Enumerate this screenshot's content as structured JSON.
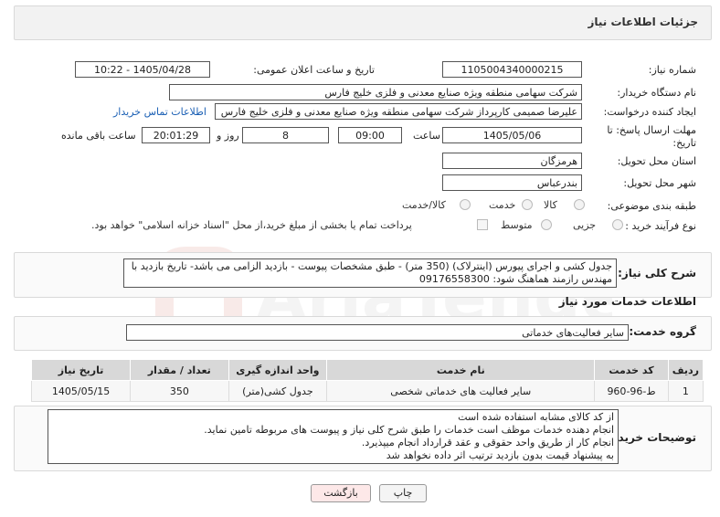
{
  "header": {
    "title": "جزئیات اطلاعات نیاز"
  },
  "fields": {
    "need_number_label": "شماره نیاز:",
    "need_number": "1105004340000215",
    "announce_label": "تاریخ و ساعت اعلان عمومی:",
    "announce_value": "1405/04/28 - 10:22",
    "buyer_label": "نام دستگاه خریدار:",
    "buyer_value": "شرکت سهامی منطقه ویژه صنایع معدنی و فلزی خلیج فارس",
    "creator_label": "ایجاد کننده درخواست:",
    "creator_value": "علیرضا صمیمی کارپرداز شرکت سهامی منطقه ویژه صنایع معدنی و فلزی خلیج فارس",
    "contact_link": "اطلاعات تماس خریدار",
    "deadline_label": "مهلت ارسال پاسخ: تا تاریخ:",
    "deadline_date": "1405/05/06",
    "time_label": "ساعت",
    "deadline_time": "09:00",
    "days_value": "8",
    "days_label": "روز و",
    "remaining_value": "20:01:29",
    "remaining_label": "ساعت باقی مانده",
    "province_label": "استان محل تحویل:",
    "province_value": "هرمزگان",
    "city_label": "شهر محل تحویل:",
    "city_value": "بندرعباس",
    "category_label": "طبقه بندی موضوعی:",
    "category_options": [
      "کالا",
      "خدمت",
      "کالا/خدمت"
    ],
    "process_label": "نوع فرآیند خرید :",
    "process_options": [
      "جزیی",
      "متوسط"
    ],
    "payment_note": "پرداخت تمام یا بخشی از مبلغ خرید،از محل \"اسناد خزانه اسلامی\" خواهد بود."
  },
  "summary": {
    "label": "شرح کلی نیاز:",
    "text": "جدول کشی و اجرای پیورس (اینترلاک) (350 متر) - طبق مشخصات پیوست - بازدید الزامی می باشد- تاریخ بازدید با مهندس رازمند هماهنگ شود: 09176558300"
  },
  "services": {
    "section_title": "اطلاعات خدمات مورد نیاز",
    "group_label": "گروه خدمت:",
    "group_value": "سایر فعالیت‌های خدماتی",
    "columns": [
      "ردیف",
      "کد خدمت",
      "نام خدمت",
      "واحد اندازه گیری",
      "تعداد / مقدار",
      "تاریخ نیاز"
    ],
    "rows": [
      [
        "1",
        "ط-96-960",
        "سایر فعالیت های خدماتی شخصی",
        "جدول کشی(متر)",
        "350",
        "1405/05/15"
      ]
    ]
  },
  "notes": {
    "label": "توضیحات خریدار:",
    "lines": [
      "از کد کالای مشابه استفاده شده است",
      "انجام دهنده خدمات موظف است خدمات را طبق شرح کلی نیاز و پیوست های مربوطه تامین نماید.",
      "انجام کار از طریق واحد حقوقی و عقد قرارداد انجام میپذیرد.",
      "به پیشنهاد قیمت بدون بازدید ترتیب اثر داده نخواهد شد"
    ]
  },
  "buttons": {
    "print": "چاپ",
    "back": "بازگشت"
  },
  "watermark": "AriaTender.net",
  "colors": {
    "link": "#1a5fb4",
    "back_button": "#fde8e8",
    "header_bg": "#f2f2f2"
  }
}
